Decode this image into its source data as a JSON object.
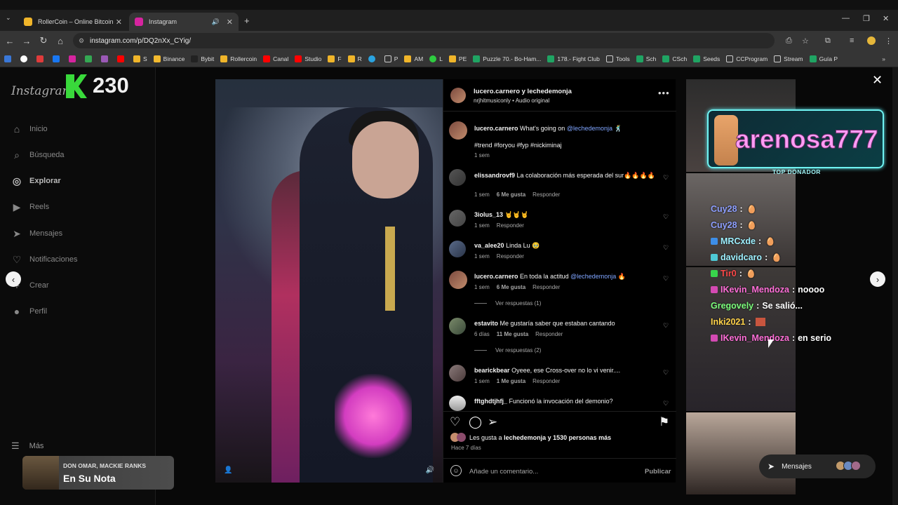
{
  "browser": {
    "tabs": [
      {
        "title": "RollerCoin – Online Bitcoin Min",
        "fav_color": "#f0b52a"
      },
      {
        "title": "Instagram",
        "fav_color": "#d6249f"
      }
    ],
    "url": "instagram.com/p/DQ2nXx_CYig/",
    "bookmarks": [
      "",
      "",
      "",
      "",
      "",
      "",
      "",
      "",
      "S",
      "Binance",
      "Bybit",
      "Rollercoin",
      "Canal",
      "Studio",
      "F",
      "R",
      "",
      "P",
      "AM",
      "L",
      "PE",
      "Puzzle 70.- Bo-Ham...",
      "178.- Fight Club",
      "Tools",
      "Sch",
      "CSch",
      "Seeds",
      "CCProgram",
      "Stream",
      "Guía P"
    ]
  },
  "sidebar": {
    "logo": "Instagram",
    "badge_count": "230",
    "items": [
      {
        "label": "Inicio",
        "icon": "⌂"
      },
      {
        "label": "Búsqueda",
        "icon": "⌕"
      },
      {
        "label": "Explorar",
        "icon": "◎"
      },
      {
        "label": "Reels",
        "icon": "▶"
      },
      {
        "label": "Mensajes",
        "icon": "➤"
      },
      {
        "label": "Notificaciones",
        "icon": "♡"
      },
      {
        "label": "Crear",
        "icon": "+"
      },
      {
        "label": "Perfil",
        "icon": "●"
      }
    ],
    "more_label": "Más"
  },
  "post": {
    "header_user": "lucero.carnero y lechedemonja",
    "header_sub": "nrjhitmusiconly • Audio original",
    "caption": {
      "user": "lucero.carnero",
      "text": "What's going on",
      "mention": "@lechedemonja",
      "emoji": "🕺",
      "hashtags": "#trend #foryou #fyp #nickiminaj",
      "time": "1 sem"
    },
    "comments": [
      {
        "user": "elissandrovf9",
        "text": "La colaboración más esperada del sur🔥🔥🔥🔥",
        "time": "1 sem",
        "likes": "6 Me gusta",
        "reply": "Responder"
      },
      {
        "user": "3iolus_13",
        "text": "🤘🤘🤘",
        "time": "1 sem",
        "likes": "",
        "reply": "Responder"
      },
      {
        "user": "va_alee20",
        "text": "Linda Lu 🥹",
        "time": "1 sem",
        "likes": "",
        "reply": "Responder"
      },
      {
        "user": "lucero.carnero",
        "text": "En toda la actitud",
        "mention": "@lechedemonja",
        "emoji": "🔥",
        "time": "1 sem",
        "likes": "6 Me gusta",
        "reply": "Responder",
        "view_replies": "Ver respuestas (1)"
      },
      {
        "user": "estavito",
        "text": "Me gustaría saber que estaban cantando",
        "time": "6 días",
        "likes": "11 Me gusta",
        "reply": "Responder",
        "view_replies": "Ver respuestas (2)"
      },
      {
        "user": "bearickbear",
        "text": "Oyeee, ese Cross-over no lo vi venir....",
        "time": "1 sem",
        "likes": "1 Me gusta",
        "reply": "Responder"
      },
      {
        "user": "fftghdtjhfj_",
        "text": "Funcionó la invocación del demonio?",
        "time": "",
        "likes": "",
        "reply": ""
      }
    ],
    "likes_prefix": "Les gusta a",
    "likes_user": "lechedemonja",
    "likes_suffix": "y 1530 personas más",
    "ago": "Hace 7 días",
    "comment_placeholder": "Añade un comentario...",
    "publish": "Publicar"
  },
  "stream_overlay": {
    "donor_name": "arenosa777",
    "donor_title": "TOP DONADOR",
    "chat": [
      {
        "user": "Cuy28",
        "color": "#8fa0ff",
        "badge": "",
        "msg": ""
      },
      {
        "user": "Cuy28",
        "color": "#8fa0ff",
        "badge": "",
        "msg": ""
      },
      {
        "user": "MRCxde",
        "color": "#9ef0ff",
        "badge": "#3d8ee8",
        "msg": ""
      },
      {
        "user": "davidcaro",
        "color": "#9ef0ff",
        "badge": "#4ec9d6",
        "msg": ""
      },
      {
        "user": "Tir0",
        "color": "#ff4a4a",
        "badge": "#38d44c",
        "msg": ""
      },
      {
        "user": "IKevin_Mendoza",
        "color": "#ff6fd8",
        "badge": "#d44ab3",
        "msg": "noooo"
      },
      {
        "user": "Gregovely",
        "color": "#7dff7d",
        "badge": "",
        "msg": "Se salió..."
      },
      {
        "user": "Inki2021",
        "color": "#ffd24a",
        "badge": "",
        "msg": ""
      },
      {
        "user": "IKevin_Mendoza",
        "color": "#ff6fd8",
        "badge": "#d44ab3",
        "msg": "en serio"
      }
    ]
  },
  "messages_pill": "Mensajes",
  "now_playing": {
    "artist": "DON OMAR, MACKIE RANKS",
    "song": "En Su Nota"
  }
}
